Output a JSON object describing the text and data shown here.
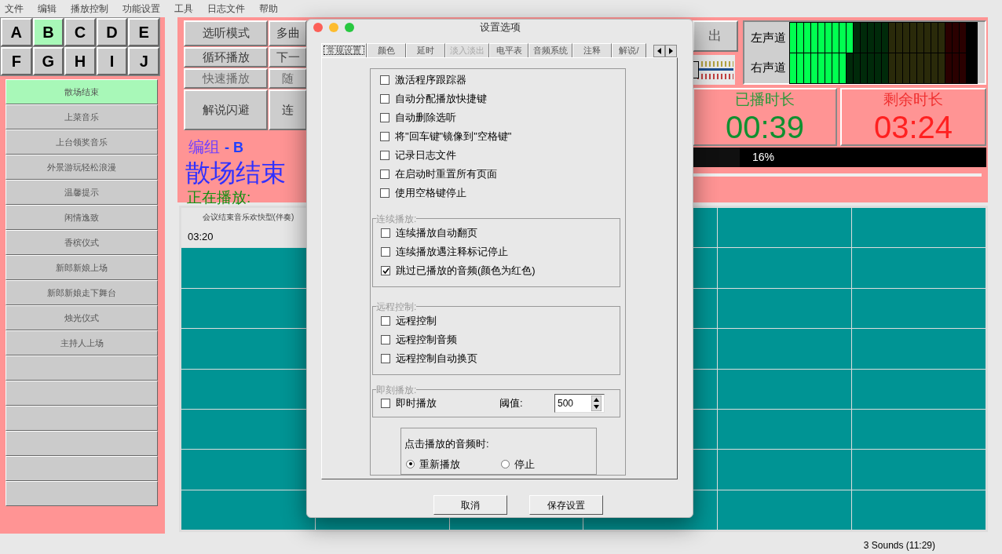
{
  "menu": [
    "文件",
    "编辑",
    "播放控制",
    "功能设置",
    "工具",
    "日志文件",
    "帮助"
  ],
  "groups": [
    {
      "label": "A",
      "selected": false
    },
    {
      "label": "B",
      "selected": true
    },
    {
      "label": "C",
      "selected": false
    },
    {
      "label": "D",
      "selected": false
    },
    {
      "label": "E",
      "selected": false
    },
    {
      "label": "F",
      "selected": false
    },
    {
      "label": "G",
      "selected": false
    },
    {
      "label": "H",
      "selected": false
    },
    {
      "label": "I",
      "selected": false
    },
    {
      "label": "J",
      "selected": false
    }
  ],
  "playlist": [
    {
      "label": "散场结束",
      "selected": true
    },
    {
      "label": "上菜音乐",
      "selected": false
    },
    {
      "label": "上台领奖音乐",
      "selected": false
    },
    {
      "label": "外景游玩轻松浪漫",
      "selected": false
    },
    {
      "label": "温馨提示",
      "selected": false
    },
    {
      "label": "闲情逸致",
      "selected": false
    },
    {
      "label": "香槟仪式",
      "selected": false
    },
    {
      "label": "新郎新娘上场",
      "selected": false
    },
    {
      "label": "新郎新娘走下舞台",
      "selected": false
    },
    {
      "label": "烛光仪式",
      "selected": false
    },
    {
      "label": "主持人上场",
      "selected": false
    }
  ],
  "controls": [
    {
      "label": "选听模式",
      "disabled": false
    },
    {
      "label": "多曲",
      "disabled": false
    },
    {
      "label": "循环播放",
      "disabled": false
    },
    {
      "label": "下一",
      "disabled": false
    },
    {
      "label": "快速播放",
      "disabled": true
    },
    {
      "label": "随",
      "disabled": true
    },
    {
      "label": "解说闪避",
      "disabled": false
    },
    {
      "label": "连",
      "disabled": false
    }
  ],
  "now_playing": {
    "group_label": "编组",
    "group_name": "- B",
    "title": "散场结束",
    "status": "正在播放:"
  },
  "exit_button": "出",
  "volume": {
    "level": 0
  },
  "meters": [
    {
      "label": "左声道",
      "level": 0.36
    },
    {
      "label": "右声道",
      "level": 0.32
    }
  ],
  "elapsed": {
    "label": "已播时长",
    "time": "00:39"
  },
  "remaining": {
    "label": "剩余时长",
    "time": "03:24"
  },
  "progress": {
    "text": "16%",
    "level": 0.16
  },
  "cues": [
    {
      "title": "会议结束音乐欢快型(伴奏)",
      "duration": "03:20"
    }
  ],
  "status_bar": "3 Sounds (11:29)",
  "dialog": {
    "title": "设置选项",
    "tabs": [
      {
        "label": "常规设置",
        "selected": true,
        "disabled": false
      },
      {
        "label": "颜色",
        "selected": false,
        "disabled": false
      },
      {
        "label": "延时",
        "selected": false,
        "disabled": false
      },
      {
        "label": "淡入淡出",
        "selected": false,
        "disabled": true
      },
      {
        "label": "电平表",
        "selected": false,
        "disabled": false
      },
      {
        "label": "音频系统",
        "selected": false,
        "disabled": false
      },
      {
        "label": "注释",
        "selected": false,
        "disabled": false
      },
      {
        "label": "解说/",
        "selected": false,
        "disabled": false
      }
    ],
    "options": [
      {
        "label": "激活程序跟踪器",
        "checked": false
      },
      {
        "label": "自动分配播放快捷键",
        "checked": false
      },
      {
        "label": "自动删除选听",
        "checked": false
      },
      {
        "label": "将\"回车键\"镜像到\"空格键\"",
        "checked": false
      },
      {
        "label": "记录日志文件",
        "checked": false
      },
      {
        "label": "在启动时重置所有页面",
        "checked": false
      },
      {
        "label": "使用空格键停止",
        "checked": false
      }
    ],
    "sections": [
      {
        "label": "连续播放:",
        "options": [
          {
            "label": "连续播放自动翻页",
            "checked": false
          },
          {
            "label": "连续播放遇注释标记停止",
            "checked": false
          },
          {
            "label": "跳过已播放的音频(颜色为红色)",
            "checked": true
          }
        ]
      },
      {
        "label": "远程控制:",
        "options": [
          {
            "label": "远程控制",
            "checked": false
          },
          {
            "label": "远程控制音频",
            "checked": false
          },
          {
            "label": "远程控制自动换页",
            "checked": false
          }
        ]
      }
    ],
    "instant": {
      "label": "即刻播放:",
      "option": {
        "label": "即时播放",
        "checked": false
      },
      "threshold_label": "阈值:",
      "threshold": "500"
    },
    "click_action": {
      "label": "点击播放的音频时:",
      "choices": [
        {
          "label": "重新播放",
          "selected": true
        },
        {
          "label": "停止",
          "selected": false
        }
      ]
    },
    "buttons": [
      "取消",
      "保存设置"
    ]
  }
}
